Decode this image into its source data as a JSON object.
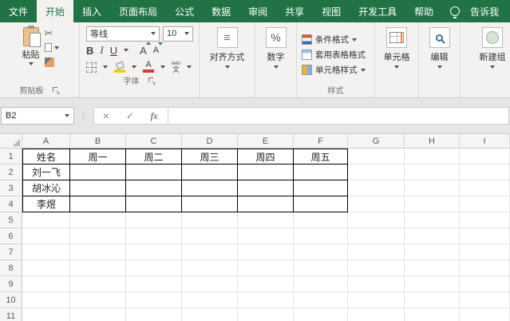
{
  "colors": {
    "green": "#217346",
    "tab_bg": "#f3f2f1",
    "yellow": "#f3cc17",
    "red": "#d93a2b"
  },
  "titlebar": {
    "tabs": [
      "文件",
      "开始",
      "插入",
      "页面布局",
      "公式",
      "数据",
      "审阅",
      "共享",
      "视图",
      "开发工具",
      "帮助"
    ],
    "active_tab": "开始",
    "tell_me": "告诉我"
  },
  "ribbon": {
    "clipboard": {
      "paste": "粘贴",
      "group": "剪贴板"
    },
    "font": {
      "name": "等线",
      "size": "10",
      "bold": "B",
      "italic": "I",
      "underline": "U",
      "grow": "A",
      "shrink": "A",
      "pinyin_top": "wén",
      "pinyin_bottom": "文",
      "group": "字体"
    },
    "alignment": {
      "label": "对齐方式"
    },
    "number": {
      "percent": "%",
      "label": "数字"
    },
    "styles": {
      "conditional": "条件格式",
      "format_table": "套用表格格式",
      "cell_styles": "单元格样式",
      "group": "样式"
    },
    "cells": {
      "label": "单元格"
    },
    "editing": {
      "label": "编辑"
    },
    "new_group": {
      "label": "新建组"
    }
  },
  "formula_bar": {
    "name_box": "B2",
    "cancel": "×",
    "enter": "✓",
    "fx": "fx",
    "dots": "⋮"
  },
  "grid": {
    "columns": [
      "A",
      "B",
      "C",
      "D",
      "E",
      "F",
      "G",
      "H",
      "I"
    ],
    "rows": [
      "1",
      "2",
      "3",
      "4",
      "5",
      "6",
      "7",
      "8",
      "9",
      "10",
      "11"
    ],
    "table": {
      "range": "A1:F4",
      "rows": [
        [
          "姓名",
          "周一",
          "周二",
          "周三",
          "周四",
          "周五"
        ],
        [
          "刘一飞",
          "",
          "",
          "",
          "",
          ""
        ],
        [
          "胡冰沁",
          "",
          "",
          "",
          "",
          ""
        ],
        [
          "李煜",
          "",
          "",
          "",
          "",
          ""
        ]
      ]
    }
  }
}
